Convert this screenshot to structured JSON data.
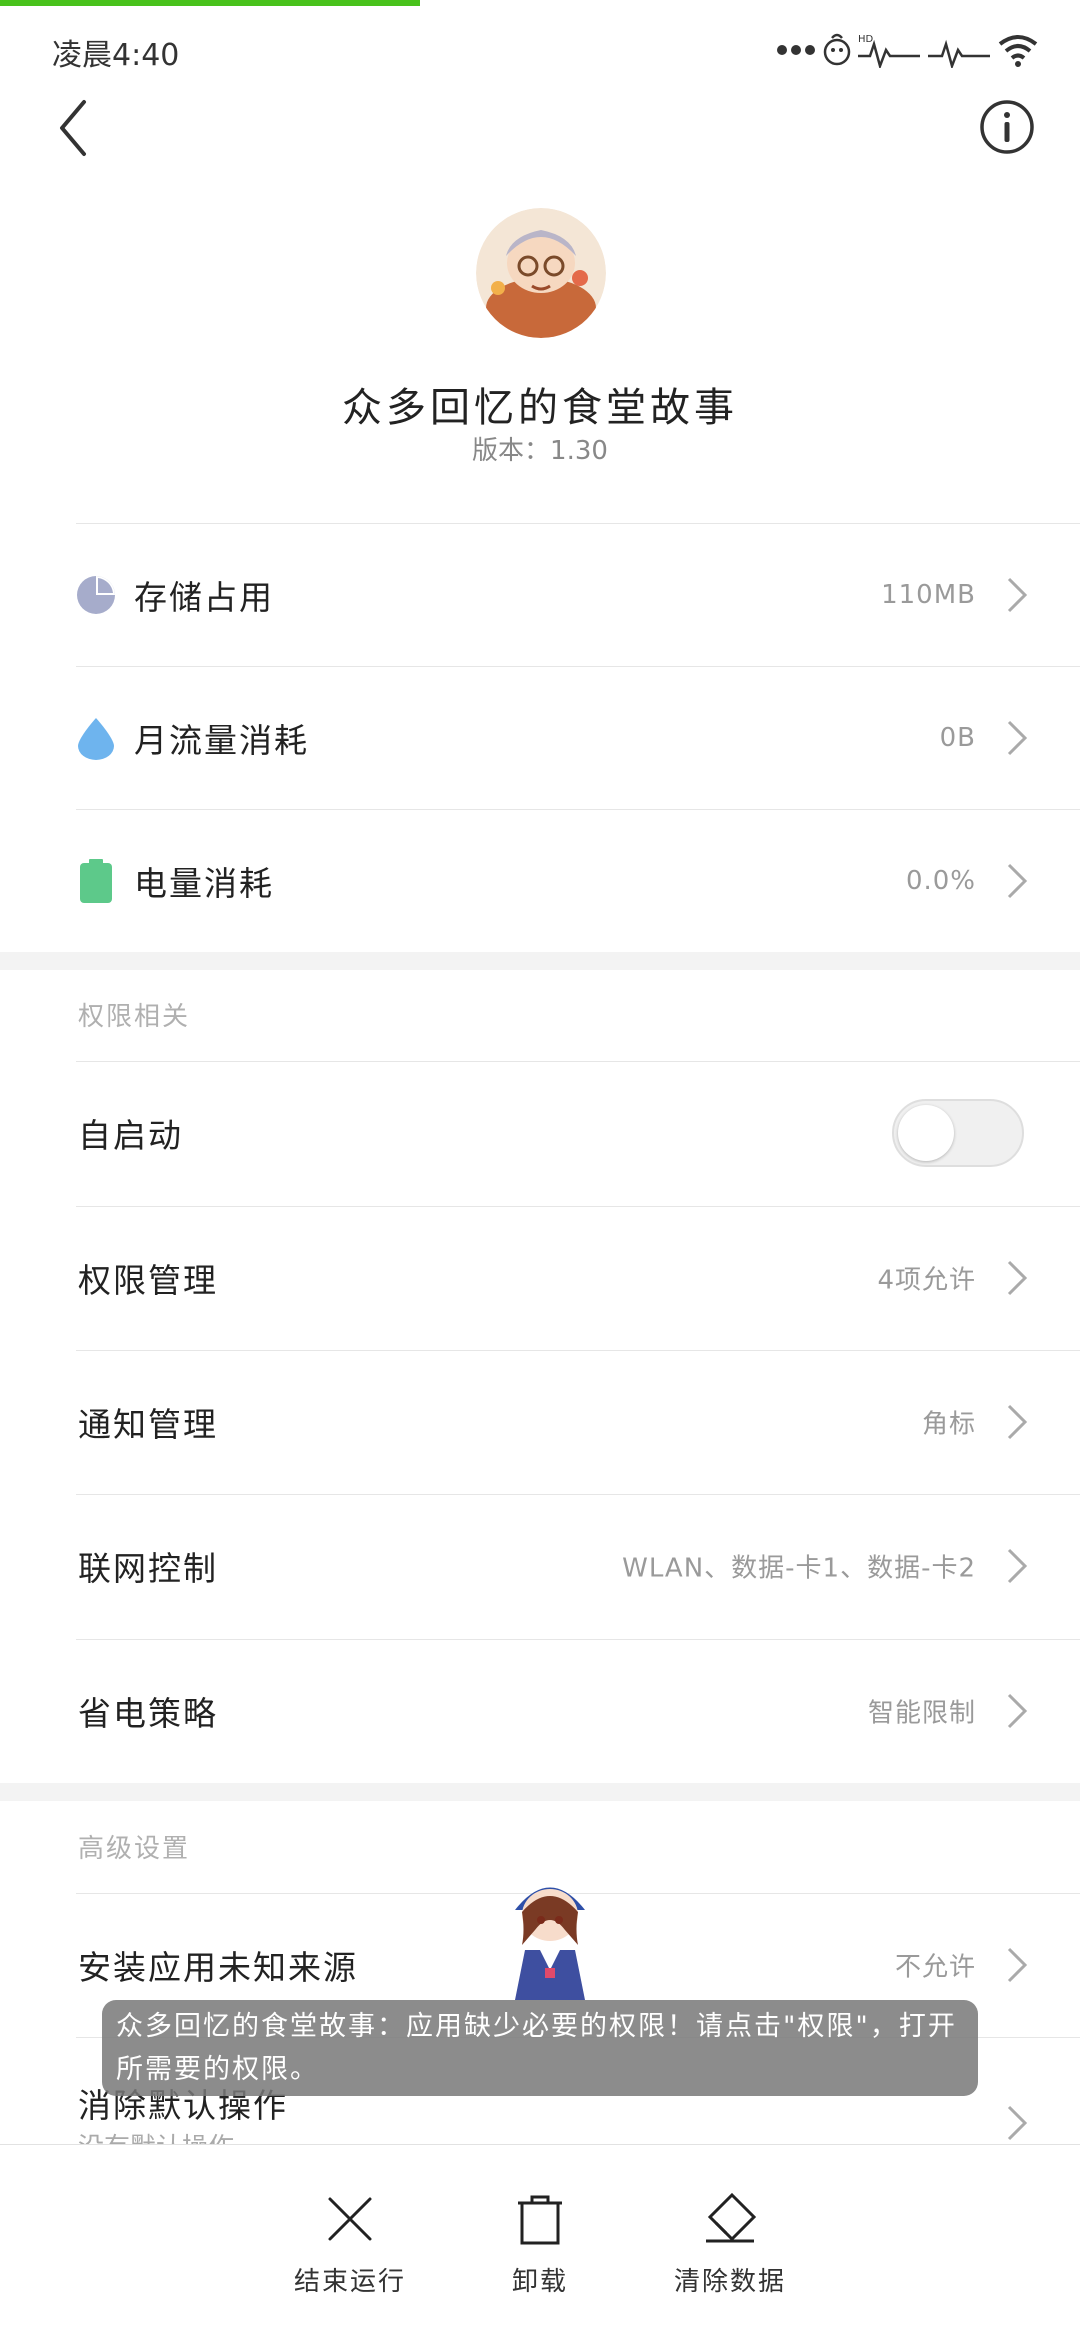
{
  "status_bar": {
    "time": "凌晨4:40"
  },
  "app": {
    "name": "众多回忆的食堂故事",
    "version": "版本：1.30"
  },
  "usage": [
    {
      "label": "存储占用",
      "value": "110MB",
      "icon": "pie-chart-icon",
      "color": "#a6accb"
    },
    {
      "label": "月流量消耗",
      "value": "0B",
      "icon": "water-drop-icon",
      "color": "#6eb4ee"
    },
    {
      "label": "电量消耗",
      "value": "0.0%",
      "icon": "battery-icon",
      "color": "#5dc98a"
    }
  ],
  "permissions": {
    "title": "权限相关",
    "autostart": {
      "label": "自启动",
      "enabled": false
    },
    "items": [
      {
        "label": "权限管理",
        "value": "4项允许"
      },
      {
        "label": "通知管理",
        "value": "角标"
      },
      {
        "label": "联网控制",
        "value": "WLAN、数据-卡1、数据-卡2"
      },
      {
        "label": "省电策略",
        "value": "智能限制"
      }
    ]
  },
  "advanced": {
    "title": "高级设置",
    "items": [
      {
        "label": "安装应用未知来源",
        "value": "不允许"
      },
      {
        "label": "消除默认操作",
        "sub": "没有默认操作"
      }
    ]
  },
  "toast": {
    "text": "众多回忆的食堂故事：应用缺少必要的权限！请点击\"权限\"，打开所需要的权限。"
  },
  "actions": [
    {
      "label": "结束运行",
      "icon": "close-icon"
    },
    {
      "label": "卸载",
      "icon": "trash-icon"
    },
    {
      "label": "清除数据",
      "icon": "eraser-icon"
    }
  ],
  "accent_color": "#49c21c",
  "page_load_progress": 0.39
}
